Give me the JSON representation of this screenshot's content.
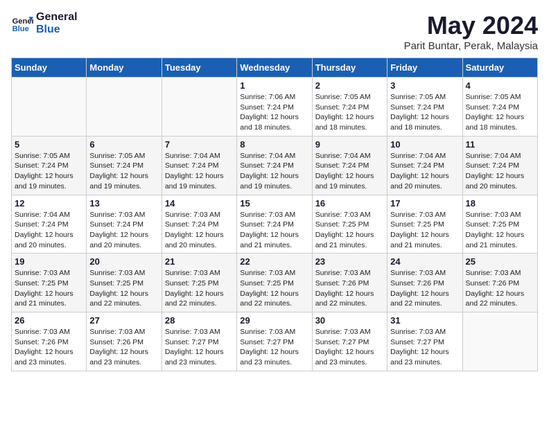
{
  "logo": {
    "line1": "General",
    "line2": "Blue"
  },
  "title": "May 2024",
  "location": "Parit Buntar, Perak, Malaysia",
  "weekdays": [
    "Sunday",
    "Monday",
    "Tuesday",
    "Wednesday",
    "Thursday",
    "Friday",
    "Saturday"
  ],
  "weeks": [
    [
      {
        "day": null,
        "info": null
      },
      {
        "day": null,
        "info": null
      },
      {
        "day": null,
        "info": null
      },
      {
        "day": "1",
        "info": "Sunrise: 7:06 AM\nSunset: 7:24 PM\nDaylight: 12 hours\nand 18 minutes."
      },
      {
        "day": "2",
        "info": "Sunrise: 7:05 AM\nSunset: 7:24 PM\nDaylight: 12 hours\nand 18 minutes."
      },
      {
        "day": "3",
        "info": "Sunrise: 7:05 AM\nSunset: 7:24 PM\nDaylight: 12 hours\nand 18 minutes."
      },
      {
        "day": "4",
        "info": "Sunrise: 7:05 AM\nSunset: 7:24 PM\nDaylight: 12 hours\nand 18 minutes."
      }
    ],
    [
      {
        "day": "5",
        "info": "Sunrise: 7:05 AM\nSunset: 7:24 PM\nDaylight: 12 hours\nand 19 minutes."
      },
      {
        "day": "6",
        "info": "Sunrise: 7:05 AM\nSunset: 7:24 PM\nDaylight: 12 hours\nand 19 minutes."
      },
      {
        "day": "7",
        "info": "Sunrise: 7:04 AM\nSunset: 7:24 PM\nDaylight: 12 hours\nand 19 minutes."
      },
      {
        "day": "8",
        "info": "Sunrise: 7:04 AM\nSunset: 7:24 PM\nDaylight: 12 hours\nand 19 minutes."
      },
      {
        "day": "9",
        "info": "Sunrise: 7:04 AM\nSunset: 7:24 PM\nDaylight: 12 hours\nand 19 minutes."
      },
      {
        "day": "10",
        "info": "Sunrise: 7:04 AM\nSunset: 7:24 PM\nDaylight: 12 hours\nand 20 minutes."
      },
      {
        "day": "11",
        "info": "Sunrise: 7:04 AM\nSunset: 7:24 PM\nDaylight: 12 hours\nand 20 minutes."
      }
    ],
    [
      {
        "day": "12",
        "info": "Sunrise: 7:04 AM\nSunset: 7:24 PM\nDaylight: 12 hours\nand 20 minutes."
      },
      {
        "day": "13",
        "info": "Sunrise: 7:03 AM\nSunset: 7:24 PM\nDaylight: 12 hours\nand 20 minutes."
      },
      {
        "day": "14",
        "info": "Sunrise: 7:03 AM\nSunset: 7:24 PM\nDaylight: 12 hours\nand 20 minutes."
      },
      {
        "day": "15",
        "info": "Sunrise: 7:03 AM\nSunset: 7:24 PM\nDaylight: 12 hours\nand 21 minutes."
      },
      {
        "day": "16",
        "info": "Sunrise: 7:03 AM\nSunset: 7:25 PM\nDaylight: 12 hours\nand 21 minutes."
      },
      {
        "day": "17",
        "info": "Sunrise: 7:03 AM\nSunset: 7:25 PM\nDaylight: 12 hours\nand 21 minutes."
      },
      {
        "day": "18",
        "info": "Sunrise: 7:03 AM\nSunset: 7:25 PM\nDaylight: 12 hours\nand 21 minutes."
      }
    ],
    [
      {
        "day": "19",
        "info": "Sunrise: 7:03 AM\nSunset: 7:25 PM\nDaylight: 12 hours\nand 21 minutes."
      },
      {
        "day": "20",
        "info": "Sunrise: 7:03 AM\nSunset: 7:25 PM\nDaylight: 12 hours\nand 22 minutes."
      },
      {
        "day": "21",
        "info": "Sunrise: 7:03 AM\nSunset: 7:25 PM\nDaylight: 12 hours\nand 22 minutes."
      },
      {
        "day": "22",
        "info": "Sunrise: 7:03 AM\nSunset: 7:25 PM\nDaylight: 12 hours\nand 22 minutes."
      },
      {
        "day": "23",
        "info": "Sunrise: 7:03 AM\nSunset: 7:26 PM\nDaylight: 12 hours\nand 22 minutes."
      },
      {
        "day": "24",
        "info": "Sunrise: 7:03 AM\nSunset: 7:26 PM\nDaylight: 12 hours\nand 22 minutes."
      },
      {
        "day": "25",
        "info": "Sunrise: 7:03 AM\nSunset: 7:26 PM\nDaylight: 12 hours\nand 22 minutes."
      }
    ],
    [
      {
        "day": "26",
        "info": "Sunrise: 7:03 AM\nSunset: 7:26 PM\nDaylight: 12 hours\nand 23 minutes."
      },
      {
        "day": "27",
        "info": "Sunrise: 7:03 AM\nSunset: 7:26 PM\nDaylight: 12 hours\nand 23 minutes."
      },
      {
        "day": "28",
        "info": "Sunrise: 7:03 AM\nSunset: 7:27 PM\nDaylight: 12 hours\nand 23 minutes."
      },
      {
        "day": "29",
        "info": "Sunrise: 7:03 AM\nSunset: 7:27 PM\nDaylight: 12 hours\nand 23 minutes."
      },
      {
        "day": "30",
        "info": "Sunrise: 7:03 AM\nSunset: 7:27 PM\nDaylight: 12 hours\nand 23 minutes."
      },
      {
        "day": "31",
        "info": "Sunrise: 7:03 AM\nSunset: 7:27 PM\nDaylight: 12 hours\nand 23 minutes."
      },
      {
        "day": null,
        "info": null
      }
    ]
  ]
}
